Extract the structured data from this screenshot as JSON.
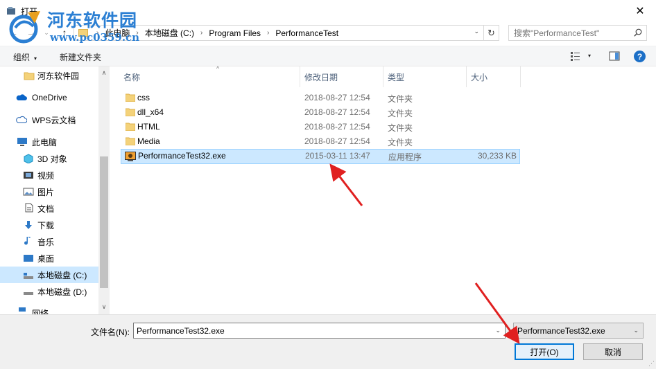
{
  "window": {
    "title": "打开",
    "close_glyph": "✕"
  },
  "watermark": {
    "title": "河东软件园",
    "url": "www.pc0359.cn"
  },
  "nav": {
    "back_glyph": "←",
    "forward_glyph": "→",
    "up_glyph": "↑",
    "breadcrumbs": [
      "此电脑",
      "本地磁盘 (C:)",
      "Program Files",
      "PerformanceTest"
    ],
    "separator": "›",
    "refresh_glyph": "↻",
    "dropdown_glyph": "⌄"
  },
  "search": {
    "placeholder": "搜索\"PerformanceTest\""
  },
  "toolbar": {
    "organize_label": "组织",
    "new_folder_label": "新建文件夹",
    "caret": "▾",
    "help_glyph": "?"
  },
  "sidebar": {
    "items": [
      {
        "label": "河东软件园",
        "icon": "folder-icon"
      },
      {
        "label": "OneDrive",
        "icon": "cloud-icon"
      },
      {
        "label": "WPS云文档",
        "icon": "cloud-icon"
      },
      {
        "label": "此电脑",
        "icon": "computer-icon"
      },
      {
        "label": "3D 对象",
        "icon": "cube-icon"
      },
      {
        "label": "视频",
        "icon": "video-icon"
      },
      {
        "label": "图片",
        "icon": "picture-icon"
      },
      {
        "label": "文档",
        "icon": "document-icon"
      },
      {
        "label": "下载",
        "icon": "download-icon"
      },
      {
        "label": "音乐",
        "icon": "music-icon"
      },
      {
        "label": "桌面",
        "icon": "desktop-icon"
      },
      {
        "label": "本地磁盘 (C:)",
        "icon": "drive-icon",
        "selected": true
      },
      {
        "label": "本地磁盘 (D:)",
        "icon": "drive-icon"
      },
      {
        "label": "网络",
        "icon": "network-icon"
      }
    ],
    "scroll_up": "∧",
    "scroll_down": "∨"
  },
  "files": {
    "columns": [
      "名称",
      "修改日期",
      "类型",
      "大小"
    ],
    "sort_caret": "^",
    "rows": [
      {
        "name": "css",
        "date": "2018-08-27 12:54",
        "type": "文件夹",
        "size": "",
        "icon": "folder-icon"
      },
      {
        "name": "dll_x64",
        "date": "2018-08-27 12:54",
        "type": "文件夹",
        "size": "",
        "icon": "folder-icon"
      },
      {
        "name": "HTML",
        "date": "2018-08-27 12:54",
        "type": "文件夹",
        "size": "",
        "icon": "folder-icon"
      },
      {
        "name": "Media",
        "date": "2018-08-27 12:54",
        "type": "文件夹",
        "size": "",
        "icon": "folder-icon"
      },
      {
        "name": "PerformanceTest32.exe",
        "date": "2015-03-11 13:47",
        "type": "应用程序",
        "size": "30,233 KB",
        "icon": "exe-icon",
        "selected": true
      }
    ]
  },
  "footer": {
    "filename_label": "文件名(N):",
    "filename_value": "PerformanceTest32.exe",
    "filetype_value": "PerformanceTest32.exe",
    "open_label": "打开(O)",
    "cancel_label": "取消",
    "caret": "⌄"
  },
  "colors": {
    "selection": "#cce8ff",
    "accent": "#0078d7",
    "annotation_arrow": "#e02020",
    "watermark": "#2b7fd3"
  }
}
